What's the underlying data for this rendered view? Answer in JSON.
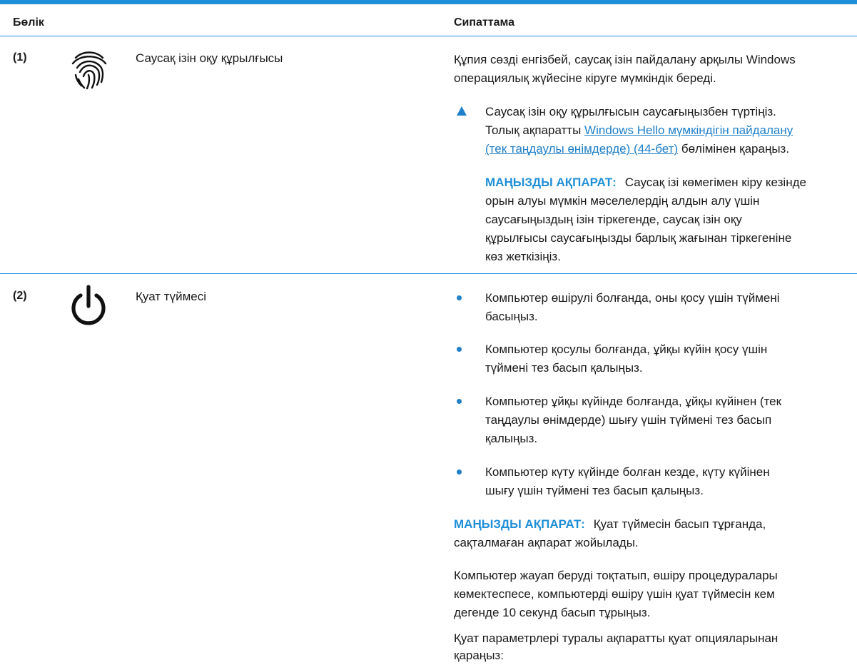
{
  "table": {
    "header": {
      "part": "Бөлік",
      "description": "Сипаттама"
    },
    "rows": [
      {
        "number": "(1)",
        "icon": "fingerprint-icon",
        "name": "Саусақ ізін оқу құрылғысы",
        "description_lines": [
          "Құпия сөзді енгізбей, саусақ ізін пайдалану арқылы Windows",
          "операциялық жүйесіне кіруге мүмкіндік береді."
        ],
        "step": {
          "line1": "Саусақ ізін оқу құрылғысын саусағыңызбен түртіңіз.",
          "line2_prefix": "Толық ақпаратты ",
          "link_line2": "Windows Hello мүмкіндігін пайдалану",
          "link_line3": "(тек таңдаулы өнімдерде) (44-бет)",
          "line3_suffix": " бөлімінен қараңыз."
        },
        "important": {
          "label": "МАҢЫЗДЫ АҚПАРАТ:",
          "lines": [
            "Саусақ ізі көмегімен кіру кезінде",
            "орын алуы мүмкін мәселелердің алдын алу үшін",
            "саусағыңыздың ізін тіркегенде, саусақ ізін оқу",
            "құрылғысы саусағыңызды барлық жағынан тіркегеніне",
            "көз жеткізіңіз."
          ]
        }
      },
      {
        "number": "(2)",
        "icon": "power-icon",
        "name": "Қуат түймесі",
        "bullets": [
          [
            "Компьютер өшірулі болғанда, оны қосу үшін түймені",
            "басыңыз."
          ],
          [
            "Компьютер қосулы болғанда, ұйқы күйін қосу үшін",
            "түймені тез басып қалыңыз."
          ],
          [
            "Компьютер ұйқы күйінде болғанда, ұйқы күйінен (тек",
            "таңдаулы өнімдерде) шығу үшін түймені тез басып",
            "қалыңыз."
          ],
          [
            "Компьютер күту күйінде болған кезде, күту күйінен",
            "шығу үшін түймені тез басып қалыңыз."
          ]
        ],
        "important": {
          "label": "МАҢЫЗДЫ АҚПАРАТ:",
          "lines": [
            "Қуат түймесін басып тұрғанда,",
            "сақталмаған ақпарат жойылады."
          ]
        },
        "paragraphs": [
          [
            "Компьютер жауап беруді тоқтатып, өшіру процедуралары",
            "көмектеспесе, компьютерді өшіру үшін қуат түймесін кем",
            "дегенде 10 секунд басып тұрыңыз."
          ],
          [
            "Қуат параметрлері туралы ақпаратты қуат опцияларынан",
            "қараңыз:"
          ]
        ]
      }
    ]
  },
  "colors": {
    "accent": "#1f8fd8",
    "link": "#1f7fc8",
    "text": "#1a1a1a"
  }
}
